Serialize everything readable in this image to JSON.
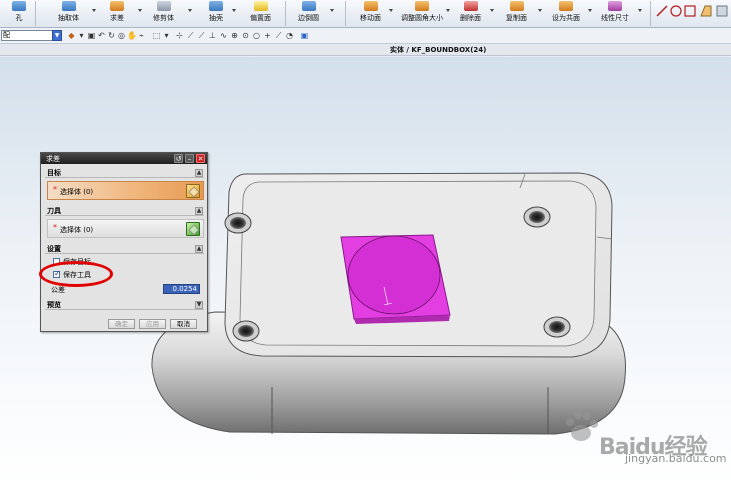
{
  "ribbon": {
    "items": [
      {
        "label": "孔",
        "icon": "hole-icon"
      },
      {
        "label": "抽取体",
        "icon": "extract-body-icon"
      },
      {
        "label": "求差",
        "icon": "subtract-icon"
      },
      {
        "label": "修剪体",
        "icon": "trim-body-icon"
      },
      {
        "label": "抽壳",
        "icon": "shell-icon"
      },
      {
        "label": "偏置面",
        "icon": "offset-face-icon"
      },
      {
        "label": "边倒圆",
        "icon": "edge-blend-icon"
      },
      {
        "label": "移动面",
        "icon": "move-face-icon"
      },
      {
        "label": "调整圆角大小",
        "icon": "resize-blend-icon"
      },
      {
        "label": "删除面",
        "icon": "delete-face-icon"
      },
      {
        "label": "复制面",
        "icon": "copy-face-icon"
      },
      {
        "label": "设为共面",
        "icon": "make-coplanar-icon"
      },
      {
        "label": "线性尺寸",
        "icon": "linear-dimension-icon"
      }
    ]
  },
  "toolbar2": {
    "filter_value": "配"
  },
  "breadcrumb": "实体 / KF_BOUNDBOX(24)",
  "dialog": {
    "title": "求差",
    "sections": {
      "target": "目标",
      "tool": "刀具",
      "settings": "设置",
      "preview": "预览"
    },
    "target_select": {
      "star": "*",
      "label": "选择体 (0)"
    },
    "tool_select": {
      "star": "*",
      "label": "选择体 (0)"
    },
    "keep_target": {
      "label": "保存目标",
      "checked": false
    },
    "keep_tool": {
      "label": "保存工具",
      "checked": true
    },
    "tolerance_label": "公差",
    "tolerance_value": "0.0254",
    "buttons": {
      "ok": "确定",
      "apply": "应用",
      "cancel": "取消"
    }
  },
  "watermark": {
    "brand": "Baidu经验",
    "url": "jingyan.baidu.com"
  },
  "colors": {
    "highlight_magenta": "#e040e0",
    "annotation_red": "#e00000",
    "selection_blue": "#3a62b8"
  }
}
